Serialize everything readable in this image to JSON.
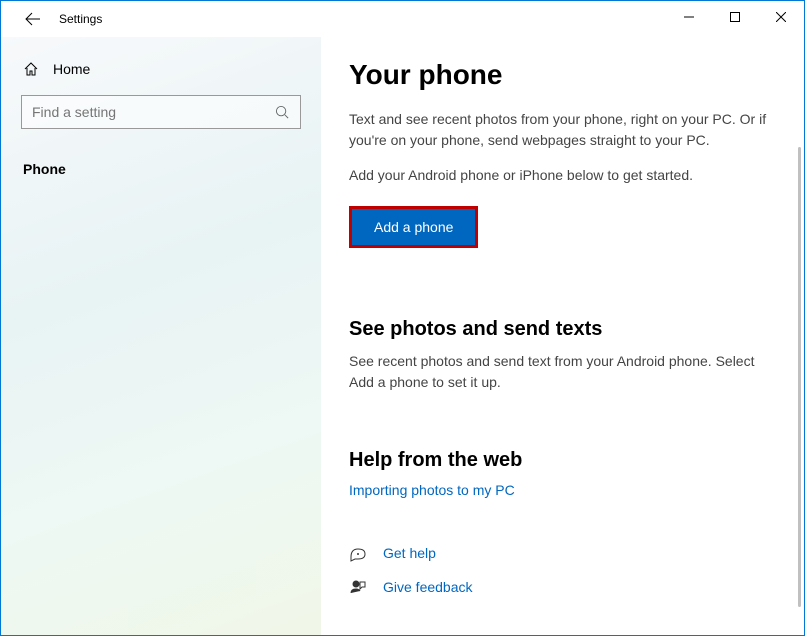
{
  "titlebar": {
    "title": "Settings"
  },
  "sidebar": {
    "home": "Home",
    "search_placeholder": "Find a setting",
    "nav": [
      "Phone"
    ]
  },
  "content": {
    "heading": "Your phone",
    "intro1": "Text and see recent photos from your phone, right on your PC. Or if you're on your phone, send webpages straight to your PC.",
    "intro2": "Add your Android phone or iPhone below to get started.",
    "add_button": "Add a phone",
    "photos_heading": "See photos and send texts",
    "photos_text": "See recent photos and send text from your Android phone. Select Add a phone to set it up.",
    "help_heading": "Help from the web",
    "help_link": "Importing photos to my PC",
    "get_help": "Get help",
    "give_feedback": "Give feedback"
  }
}
